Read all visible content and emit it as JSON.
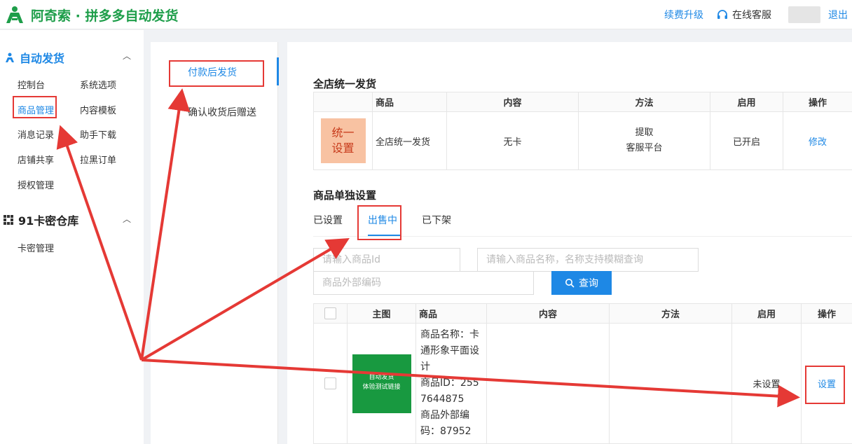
{
  "header": {
    "brand": "阿奇索 · 拼多多自动发货",
    "renew": "续费升级",
    "support": "在线客服",
    "logout": "退出"
  },
  "sidebar": {
    "section1": "自动发货",
    "items1": [
      "控制台",
      "系统选项",
      "商品管理",
      "内容模板",
      "消息记录",
      "助手下载",
      "店铺共享",
      "拉黑订单",
      "授权管理"
    ],
    "section2": "91卡密仓库",
    "items2": [
      "卡密管理"
    ]
  },
  "midmenu": {
    "items": [
      "付款后发货",
      "确认收货后赠送"
    ]
  },
  "global": {
    "title": "全店统一发货",
    "headers": [
      "商品",
      "内容",
      "方法",
      "启用",
      "操作"
    ],
    "row": {
      "tile_line1": "统一",
      "tile_line2": "设置",
      "product": "全店统一发货",
      "content": "无卡",
      "method_line1": "提取",
      "method_line2": "客服平台",
      "enabled": "已开启",
      "action": "修改"
    }
  },
  "individual": {
    "title": "商品单独设置",
    "tabs": [
      "已设置",
      "出售中",
      "已下架"
    ],
    "active_tab": "出售中",
    "filters": {
      "id_placeholder": "请输入商品Id",
      "name_placeholder": "请输入商品名称，名称支持模糊查询",
      "code_placeholder": "商品外部编码",
      "search_button": "查询"
    },
    "headers": [
      "主图",
      "商品",
      "内容",
      "方法",
      "启用",
      "操作"
    ],
    "row": {
      "image_line1": "自动发货",
      "image_line2": "体验测试链接",
      "name": "商品名称：卡通形象平面设计",
      "id": "商品ID：2557644875",
      "code": "商品外部编码：87952",
      "content": "",
      "method": "",
      "enabled": "未设置",
      "action": "设置"
    }
  },
  "colors": {
    "brand_green": "#1e9e4a",
    "link_blue": "#1e88e5",
    "annotation_red": "#e53935"
  }
}
